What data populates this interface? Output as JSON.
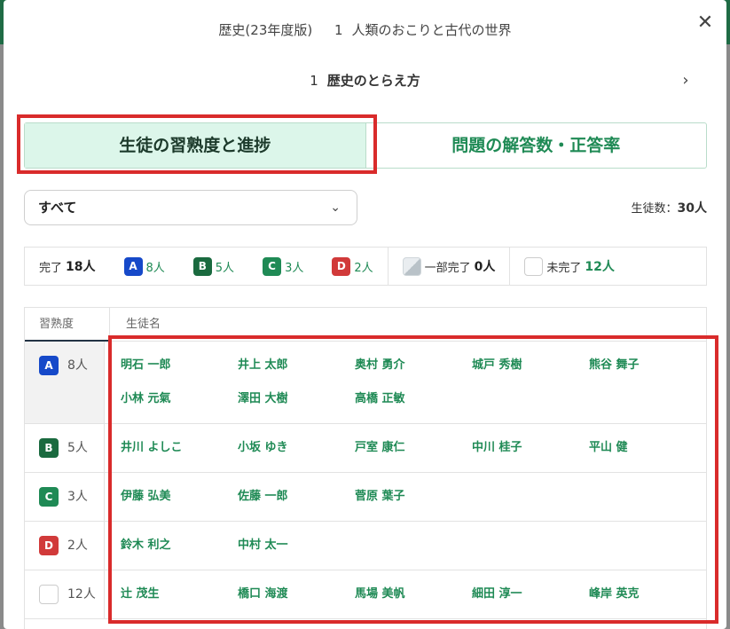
{
  "header": {
    "subject": "歴史(23年度版)",
    "chapter_number": "1",
    "chapter_title": "人類のおこりと古代の世界",
    "close_icon": "close-icon"
  },
  "unit": {
    "number": "1",
    "title": "歴史のとらえ方",
    "next_icon": "chevron-right-icon"
  },
  "tabs": [
    {
      "label": "生徒の習熟度と進捗",
      "active": true
    },
    {
      "label": "問題の解答数・正答率",
      "active": false
    }
  ],
  "filter": {
    "selected": "すべて",
    "icon": "chevron-down-icon"
  },
  "student_count": {
    "label": "生徒数：",
    "value": "30人"
  },
  "summary": {
    "complete_label": "完了",
    "complete_value": "18人",
    "a_label": "A",
    "a_value": "8人",
    "b_label": "B",
    "b_value": "5人",
    "c_label": "C",
    "c_value": "3人",
    "d_label": "D",
    "d_value": "2人",
    "partial_label": "一部完了",
    "partial_value": "0人",
    "incomplete_label": "未完了",
    "incomplete_value": "12人"
  },
  "table": {
    "col_level": "習熟度",
    "col_names": "生徒名",
    "rows": [
      {
        "badge": "A",
        "count": "8人",
        "names": [
          "明石 一郎",
          "井上 太郎",
          "奥村 勇介",
          "城戸 秀樹",
          "熊谷 舞子",
          "小林 元氣",
          "澤田 大樹",
          "高橋 正敏"
        ]
      },
      {
        "badge": "B",
        "count": "5人",
        "names": [
          "井川 よしこ",
          "小坂 ゆき",
          "戸室 康仁",
          "中川 桂子",
          "平山 健"
        ]
      },
      {
        "badge": "C",
        "count": "3人",
        "names": [
          "伊藤 弘美",
          "佐藤 一郎",
          "菅原 葉子"
        ]
      },
      {
        "badge": "D",
        "count": "2人",
        "names": [
          "鈴木 利之",
          "中村 太一"
        ]
      },
      {
        "badge": "",
        "count": "12人",
        "names": [
          "辻 茂生",
          "橋口 海渡",
          "馬場 美帆",
          "細田 淳一",
          "峰岸 英克"
        ]
      }
    ]
  },
  "colors": {
    "accent_green": "#1f8a55",
    "badge_a": "#1649c9",
    "badge_b": "#1a6a3f",
    "badge_c": "#1f8a55",
    "badge_d": "#d13a3a",
    "highlight_red": "#d92b2b",
    "active_tab_bg": "#dcf6ea"
  }
}
